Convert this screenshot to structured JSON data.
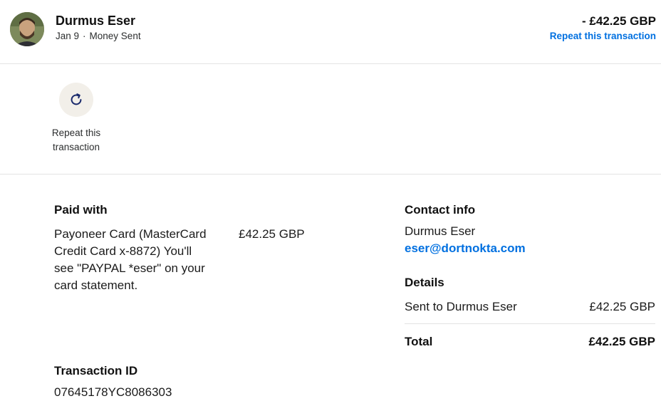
{
  "header": {
    "name": "Durmus Eser",
    "date": "Jan 9",
    "separator": "·",
    "type": "Money Sent",
    "amount": "- £42.25 GBP",
    "repeat_link": "Repeat this transaction",
    "avatar_icon": "profile-photo"
  },
  "actions": [
    {
      "label": "Repeat this transaction",
      "icon": "refresh-icon",
      "icon_color": "#1a2a6c"
    }
  ],
  "paid_with": {
    "title": "Paid with",
    "description": "Payoneer Card (MasterCard Credit Card x-8872) You'll see \"PAYPAL *eser\" on your card statement.",
    "amount": "£42.25 GBP"
  },
  "transaction": {
    "title": "Transaction ID",
    "id": "07645178YC8086303"
  },
  "contact": {
    "title": "Contact info",
    "name": "Durmus Eser",
    "email": "eser@dortnokta.com"
  },
  "details": {
    "title": "Details",
    "row_label": "Sent to Durmus Eser",
    "row_amount": "£42.25 GBP",
    "total_label": "Total",
    "total_amount": "£42.25 GBP"
  },
  "colors": {
    "link": "#0070e0",
    "action_circle": "#f2efe9",
    "divider": "#e3e3e3"
  }
}
